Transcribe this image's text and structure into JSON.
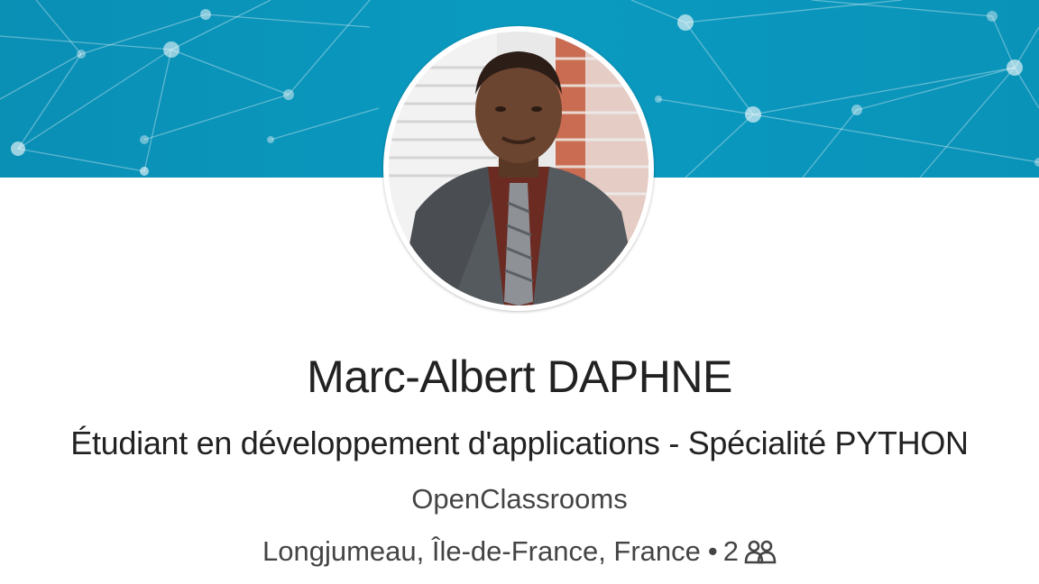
{
  "profile": {
    "name": "Marc-Albert DAPHNE",
    "headline": "Étudiant en développement d'applications - Spécialité PYTHON",
    "company": "OpenClassrooms",
    "location": "Longjumeau, Île-de-France, France",
    "separator": "•",
    "connections": "2"
  },
  "icons": {
    "connections": "people-icon"
  },
  "colors": {
    "banner": "#0a93b9",
    "text_primary": "#222222",
    "text_secondary": "#444444"
  }
}
